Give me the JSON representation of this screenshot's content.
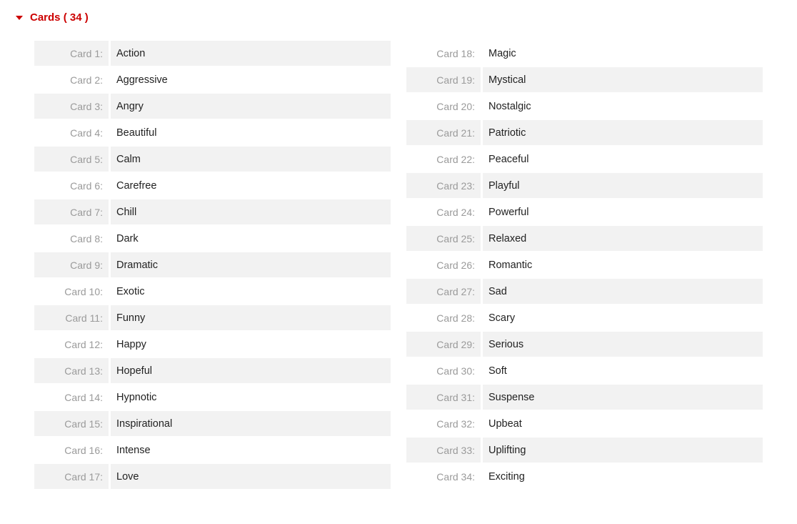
{
  "section": {
    "title_prefix": "Cards",
    "count": 34,
    "label_prefix": "Card",
    "cards": [
      "Action",
      "Aggressive",
      "Angry",
      "Beautiful",
      "Calm",
      "Carefree",
      "Chill",
      "Dark",
      "Dramatic",
      "Exotic",
      "Funny",
      "Happy",
      "Hopeful",
      "Hypnotic",
      "Inspirational",
      "Intense",
      "Love",
      "Magic",
      "Mystical",
      "Nostalgic",
      "Patriotic",
      "Peaceful",
      "Playful",
      "Powerful",
      "Relaxed",
      "Romantic",
      "Sad",
      "Scary",
      "Serious",
      "Soft",
      "Suspense",
      "Upbeat",
      "Uplifting",
      "Exciting"
    ]
  }
}
